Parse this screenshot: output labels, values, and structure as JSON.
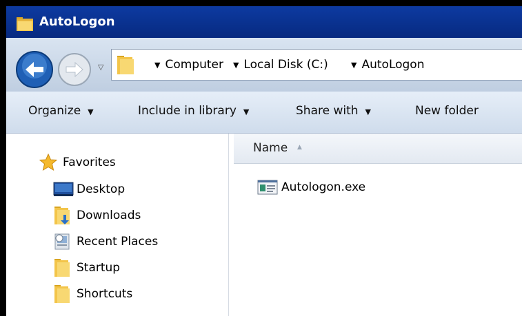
{
  "window": {
    "title": "AutoLogon"
  },
  "address": {
    "crumbs": [
      "Computer",
      "Local Disk (C:)",
      "AutoLogon"
    ]
  },
  "toolbar": {
    "organize": "Organize",
    "include_in_library": "Include in library",
    "share_with": "Share with",
    "new_folder": "New folder"
  },
  "sidebar": {
    "favorites": "Favorites",
    "items": [
      {
        "label": "Desktop",
        "icon": "desktop-icon"
      },
      {
        "label": "Downloads",
        "icon": "downloads-folder-icon"
      },
      {
        "label": "Recent Places",
        "icon": "recent-places-icon"
      },
      {
        "label": "Startup",
        "icon": "folder-icon"
      },
      {
        "label": "Shortcuts",
        "icon": "folder-icon"
      }
    ]
  },
  "content": {
    "column_name": "Name",
    "files": [
      {
        "name": "Autologon.exe",
        "icon": "exe-icon"
      }
    ]
  }
}
